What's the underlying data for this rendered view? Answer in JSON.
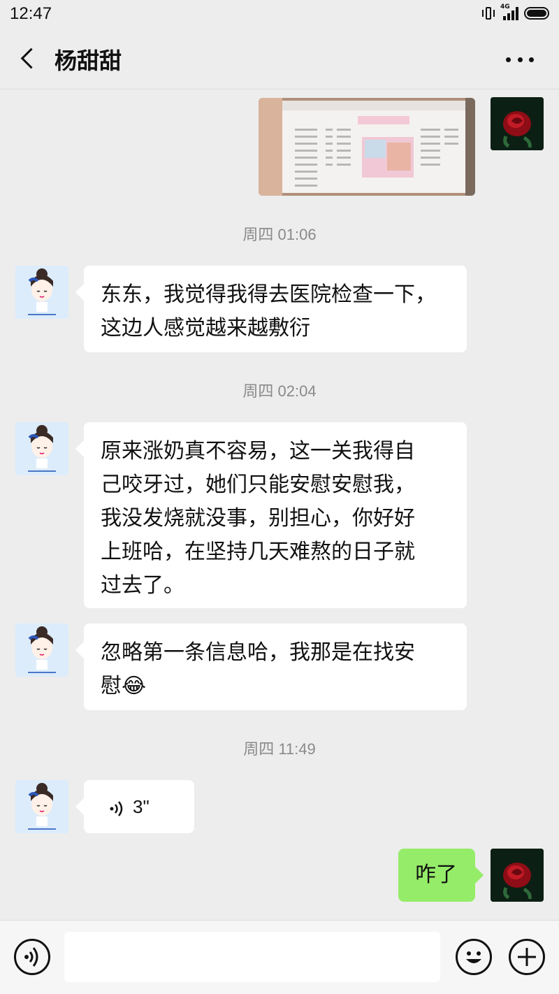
{
  "status_bar": {
    "time": "12:47",
    "network": "4G"
  },
  "header": {
    "title": "杨甜甜"
  },
  "messages": {
    "t1": "周四 01:06",
    "m1": {
      "line1": "东东，我觉得我得去医院检查一下，",
      "line2": "这边人感觉越来越敷衍"
    },
    "t2": "周四 02:04",
    "m2": {
      "line1": "原来涨奶真不容易，这一关我得自",
      "line2": "己咬牙过，她们只能安慰安慰我，",
      "line3": "我没发烧就没事，别担心，你好好",
      "line4": "上班哈，在坚持几天难熬的日子就",
      "line5": "过去了。"
    },
    "m3": {
      "line1": "忽略第一条信息哈，我那是在找安",
      "line2": "慰😂"
    },
    "t3": "周四 11:49",
    "voice": {
      "duration": "3\""
    },
    "m4": "咋了"
  },
  "input": {
    "value": ""
  },
  "icons": {
    "back": "back-icon",
    "more": "more-icon",
    "voice_toggle": "voice-mode-icon",
    "emoji": "emoji-icon",
    "add": "add-icon"
  },
  "colors": {
    "background": "#ededed",
    "sent_bubble": "#95ec69",
    "received_bubble": "#ffffff",
    "timestamp": "#8a8a8a"
  }
}
